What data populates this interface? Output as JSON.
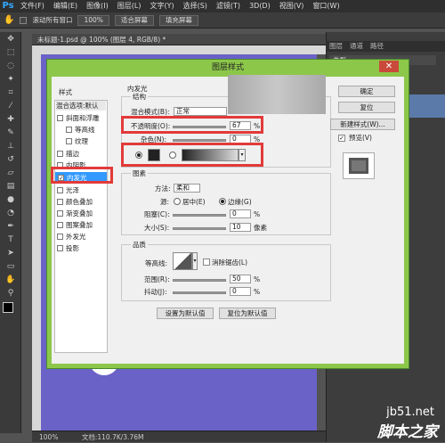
{
  "app": {
    "logo": "Ps"
  },
  "menu": [
    "文件(F)",
    "编辑(E)",
    "图像(I)",
    "图层(L)",
    "文字(Y)",
    "选择(S)",
    "滤镜(T)",
    "3D(D)",
    "视图(V)",
    "窗口(W)"
  ],
  "options_bar": {
    "checkbox_label": "滚动所有窗口",
    "zoom": "100%",
    "fit_screen": "适合屏幕",
    "fill_screen": "填充屏幕"
  },
  "document": {
    "tab_title": "未标题-1.psd @ 100% (图层 4, RGB/8) *",
    "zoom": "100%",
    "doc_size": "文档:110.7K/3.76M"
  },
  "panel": {
    "tabs": [
      "图层",
      "通道",
      "路径"
    ],
    "selector": "类型"
  },
  "dialog": {
    "title": "图层样式",
    "styles_header": "样式",
    "blend_defaults": "混合选项:默认",
    "style_items": [
      {
        "label": "斜面和浮雕",
        "checked": false
      },
      {
        "label": "等高线",
        "checked": false
      },
      {
        "label": "纹理",
        "checked": false
      },
      {
        "label": "描边",
        "checked": false
      },
      {
        "label": "内阴影",
        "checked": false
      },
      {
        "label": "内发光",
        "checked": true
      },
      {
        "label": "光泽",
        "checked": false
      },
      {
        "label": "颜色叠加",
        "checked": false
      },
      {
        "label": "渐变叠加",
        "checked": false
      },
      {
        "label": "图案叠加",
        "checked": false
      },
      {
        "label": "外发光",
        "checked": false
      },
      {
        "label": "投影",
        "checked": false
      }
    ],
    "inner_glow": {
      "section_title": "内发光",
      "structure_title": "结构",
      "blend_mode_label": "混合模式(B):",
      "blend_mode_value": "正常",
      "opacity_label": "不透明度(O):",
      "opacity_value": "67",
      "noise_label": "杂色(N):",
      "noise_value": "0",
      "percent": "%",
      "elements_title": "图素",
      "method_label": "方法:",
      "method_value": "柔和",
      "source_label": "源:",
      "source_center": "居中(E)",
      "source_edge": "边缘(G)",
      "choke_label": "阻塞(C):",
      "choke_value": "0",
      "size_label": "大小(S):",
      "size_value": "10",
      "px": "像素",
      "quality_title": "品质",
      "contour_label": "等高线:",
      "antialias_label": "消除锯齿(L)",
      "range_label": "范围(R):",
      "range_value": "50",
      "jitter_label": "抖动(J):",
      "jitter_value": "0",
      "make_default": "设置为默认值",
      "reset_default": "复位为默认值"
    },
    "buttons": {
      "ok": "确定",
      "reset": "复位",
      "new_style": "新建样式(W)...",
      "preview": "预览(V)"
    }
  },
  "watermark": {
    "line1": "jb51.net",
    "line2": "脚本之家"
  },
  "colors": {
    "canvas": "#6a62c6",
    "dialog_border": "#8cc74a",
    "highlight": "#e23a3a",
    "selected_item": "#3399ff"
  }
}
